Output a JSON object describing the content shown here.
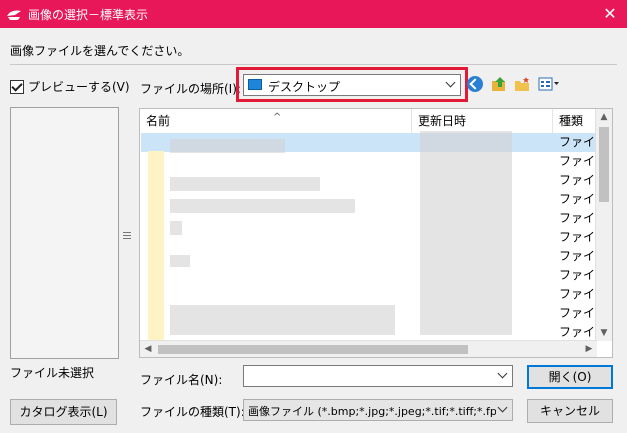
{
  "window": {
    "title": "画像の選択－標準表示",
    "close_glyph": "✕"
  },
  "prompt": "画像ファイルを選んでください。",
  "preview": {
    "checkbox_label": "プレビューする(V)",
    "checked": true,
    "status": "ファイル未選択"
  },
  "catalog_button": "カタログ表示(L)",
  "location": {
    "label": "ファイルの場所(I):",
    "value": "デスクトップ"
  },
  "toolbar": {
    "icons": [
      "back-icon",
      "up-folder-icon",
      "new-folder-icon",
      "view-menu-icon"
    ]
  },
  "file_list": {
    "columns": [
      "名前",
      "更新日時",
      "種類"
    ],
    "type_cells": [
      "ファイル",
      "ファイル",
      "ファイル",
      "ファイル",
      "ファイル",
      "ファイル",
      "ファイル",
      "ファイル",
      "ファイル",
      "ファイル",
      "ファイル"
    ]
  },
  "filename": {
    "label": "ファイル名(N):",
    "value": ""
  },
  "open_button": "開く(O)",
  "filetype": {
    "label": "ファイルの種類(T):",
    "value": "画像ファイル (*.bmp;*.jpg;*.jpeg;*.tif;*.tiff;*.fpx;*."
  },
  "cancel_button": "キャンセル",
  "colors": {
    "titlebar": "#e8175a",
    "highlight": "#e21a36",
    "selection": "#cce4f7"
  }
}
